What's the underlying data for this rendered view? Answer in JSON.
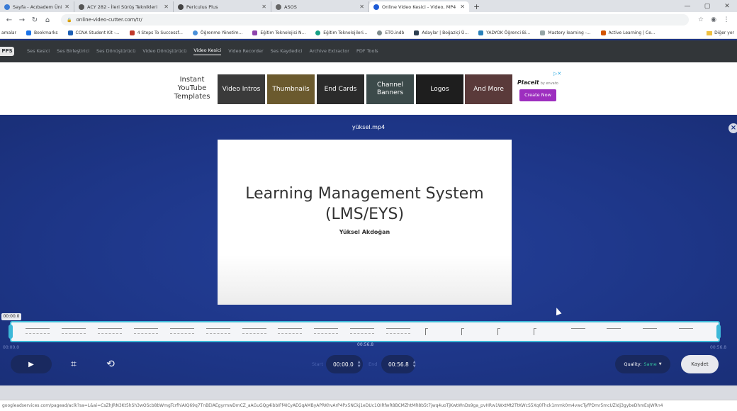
{
  "browser": {
    "tabs": [
      {
        "title": "Sayfa - Acıbadem Üniversite",
        "color": "#3a7bd5"
      },
      {
        "title": "ACY 282 - İleri Sürüş Teknikleri",
        "color": "#555555"
      },
      {
        "title": "Periculus Plus",
        "color": "#444444"
      },
      {
        "title": "ASOS",
        "color": "#666666"
      },
      {
        "title": "Online Video Kesici - Video, MP4",
        "color": "#1e5bd6"
      }
    ],
    "url": "online-video-cutter.com/tr/",
    "bookmarks": [
      {
        "label": "amalar",
        "color": "#888888"
      },
      {
        "label": "Bookmarks",
        "color": "#1a73e8"
      },
      {
        "label": "CCNA Student Kit -...",
        "color": "#1d5fb4"
      },
      {
        "label": "4 Steps To Successf...",
        "color": "#c0392b"
      },
      {
        "label": "Öğrenme Yönetim...",
        "color": "#4a90d9"
      },
      {
        "label": "Eğitim Teknolojisi N...",
        "color": "#8e44ad"
      },
      {
        "label": "Eğitim Teknolojileri...",
        "color": "#16a085"
      },
      {
        "label": "ETO.indb",
        "color": "#7f8c8d"
      },
      {
        "label": "Adaylar | Boğaziçi Ü...",
        "color": "#2c3e50"
      },
      {
        "label": "YADYOK Öğrenci Bi...",
        "color": "#2980b9"
      },
      {
        "label": "Mastery learning -...",
        "color": "#95a5a6"
      },
      {
        "label": "Active Learning | Ce...",
        "color": "#d35400"
      }
    ],
    "other_bookmarks": "Diğer yer",
    "status_url": "googleadservices.com/pagead/aclk?sa=L&ai=CsZhJRN3Kt5hSh3wOScb8bWmgTcrfhiAIQ69q7TnBEIAEgyrmwDmCZ_aAGuGQg4ibbIFf4ICyAEGqAMByAPRKhvArP4Px5NCkj1eDUc1OIRfwR8BCMZhtMR8b5t7jwq4uoTjKwtWnDs9ga_pvHRw1WxtMt2TtKWcS5Xq0Fhck1mmk0m4vwcTyfPDmr5mcUZIdj3gybeDhmEsJWRn4"
  },
  "site": {
    "logo": "PPS",
    "nav": [
      {
        "label": "Ses Kesici",
        "active": false
      },
      {
        "label": "Ses Birleştirici",
        "active": false
      },
      {
        "label": "Ses Dönüştürücü",
        "active": false
      },
      {
        "label": "Video Dönüştürücü",
        "active": false
      },
      {
        "label": "Video Kesici",
        "active": true
      },
      {
        "label": "Video Recorder",
        "active": false
      },
      {
        "label": "Ses Kaydedici",
        "active": false
      },
      {
        "label": "Archive Extractor",
        "active": false
      },
      {
        "label": "PDF Tools",
        "active": false
      }
    ]
  },
  "ad": {
    "title_lines": [
      "Instant",
      "YouTube",
      "Templates"
    ],
    "tiles": [
      {
        "label": "Video Intros",
        "color": "#3a3a3a"
      },
      {
        "label": "Thumbnails",
        "color": "#6b5a2e"
      },
      {
        "label": "End Cards",
        "color": "#2b2b2b"
      },
      {
        "label": "Channel Banners",
        "color": "#3c4a4a"
      },
      {
        "label": "Logos",
        "color": "#1e1e1e"
      },
      {
        "label": "And More",
        "color": "#5a3a3a"
      }
    ],
    "brand": "Placeit",
    "brand_sub": "by envato",
    "cta": "Create Now"
  },
  "editor": {
    "filename": "yüksel.mp4",
    "slide_title_line1": "Learning Management System",
    "slide_title_line2": "(LMS/EYS)",
    "slide_author": "Yüksel Akdoğan",
    "current_time": "00:00.0",
    "timeline_start": "00:00.0",
    "timeline_mid": "00:56.8",
    "timeline_end": "00:56.8",
    "start_label": "Start",
    "start_value": "00:00.0",
    "end_label": "End",
    "end_value": "00:56.8",
    "quality_label": "Quality:",
    "quality_value": "Same",
    "save_label": "Kaydet"
  }
}
